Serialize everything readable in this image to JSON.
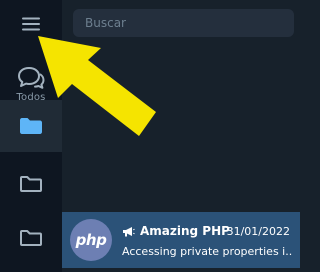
{
  "sidebar": {
    "menu_icon": "hamburger-menu-icon",
    "folders": [
      {
        "label": "Todos",
        "icon": "chat-bubbles-icon"
      },
      {
        "label": "",
        "icon": "folder-filled-icon",
        "active": true
      },
      {
        "label": "",
        "icon": "folder-outline-icon"
      },
      {
        "label": "",
        "icon": "folder-outline-icon"
      }
    ]
  },
  "search": {
    "placeholder": "Buscar"
  },
  "chats": [
    {
      "avatar_text": "php",
      "type_icon": "megaphone-icon",
      "name": "Amazing PHP",
      "date": "31/01/2022",
      "preview": "Accessing private properties i..."
    }
  ],
  "annotation": {
    "icon": "yellow-pointer-arrow"
  },
  "colors": {
    "sidebar_bg": "#0e1621",
    "active_folder_bg": "#202b36",
    "main_bg": "#17212b",
    "search_bg": "#242f3d",
    "selected_chat_bg": "#2b5278",
    "accent": "#5eb5f7",
    "arrow": "#f5e400"
  }
}
